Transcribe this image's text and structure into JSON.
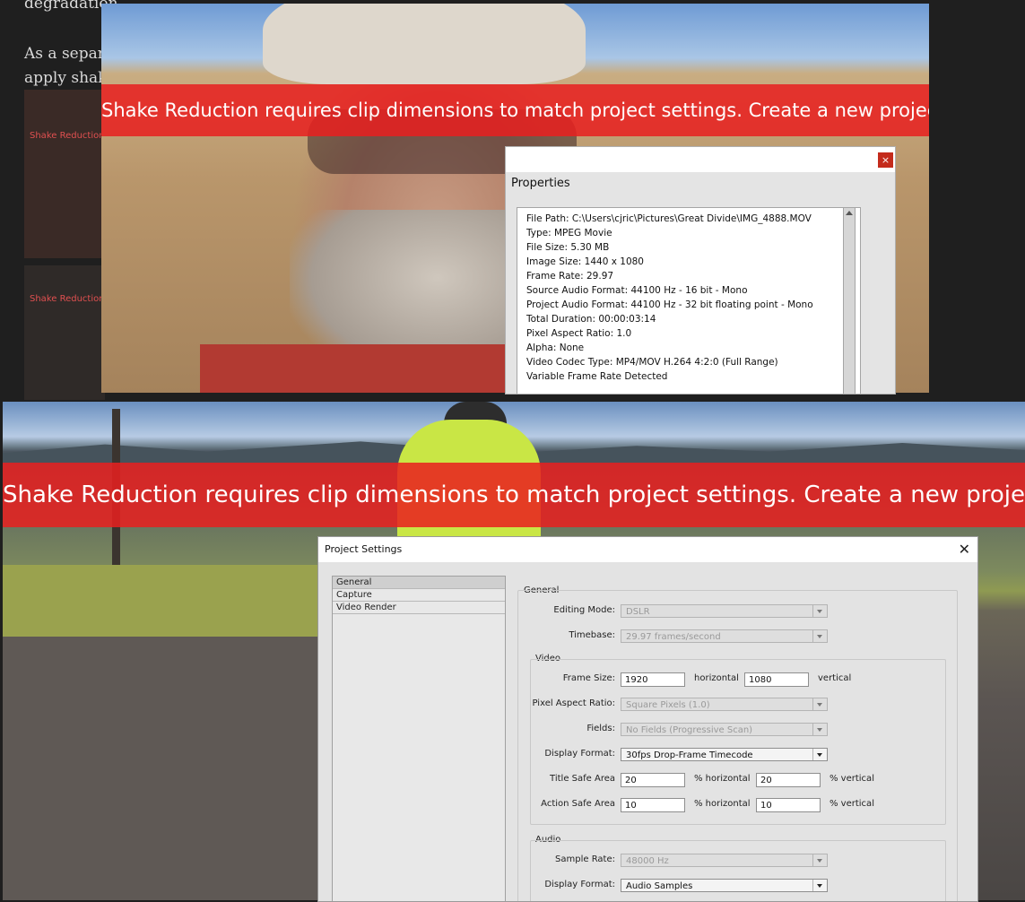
{
  "article": {
    "line1": "degradation",
    "line2": "As a separa",
    "line3": "apply shak",
    "thumb1_label": "Shake Reduction",
    "thumb2_label": "Shake Reduction"
  },
  "top_screenshot": {
    "banner": "Shake Reduction requires clip dimensions to match project settings. Create a new project."
  },
  "properties_dialog": {
    "title": "Properties",
    "close_glyph": "×",
    "lines": [
      "File Path: C:\\Users\\cjric\\Pictures\\Great Divide\\IMG_4888.MOV",
      "Type: MPEG Movie",
      "File Size: 5.30 MB",
      "Image Size: 1440 x 1080",
      "Frame Rate: 29.97",
      "Source Audio Format: 44100 Hz - 16 bit - Mono",
      "Project Audio Format: 44100 Hz - 32 bit floating point - Mono",
      "Total Duration: 00:00:03:14",
      "Pixel Aspect Ratio: 1.0",
      "Alpha: None",
      "Video Codec Type: MP4/MOV H.264 4:2:0  (Full Range)",
      "Variable Frame Rate Detected"
    ]
  },
  "bottom_screenshot": {
    "banner": "Shake Reduction requires clip dimensions to match project settings. Create a new project."
  },
  "project_settings": {
    "title": "Project Settings",
    "close_glyph": "✕",
    "nav": [
      "General",
      "Capture",
      "Video Render"
    ],
    "general_label": "General",
    "editing_mode_label": "Editing Mode:",
    "editing_mode_value": "DSLR",
    "timebase_label": "Timebase:",
    "timebase_value": "29.97 frames/second",
    "video_label": "Video",
    "frame_size_label": "Frame Size:",
    "frame_w": "1920",
    "horizontal_label": "horizontal",
    "frame_h": "1080",
    "vertical_label": "vertical",
    "par_label": "Pixel Aspect Ratio:",
    "par_value": "Square Pixels (1.0)",
    "fields_label": "Fields:",
    "fields_value": "No Fields (Progressive Scan)",
    "display_format_label": "Display Format:",
    "display_format_value": "30fps Drop-Frame Timecode",
    "title_safe_label": "Title Safe Area",
    "title_safe_h": "20",
    "pct_horizontal": "% horizontal",
    "title_safe_v": "20",
    "pct_vertical": "% vertical",
    "action_safe_label": "Action Safe Area",
    "action_safe_h": "10",
    "action_safe_v": "10",
    "audio_label": "Audio",
    "sample_rate_label": "Sample Rate:",
    "sample_rate_value": "48000 Hz",
    "audio_display_label": "Display Format:",
    "audio_display_value": "Audio Samples"
  }
}
